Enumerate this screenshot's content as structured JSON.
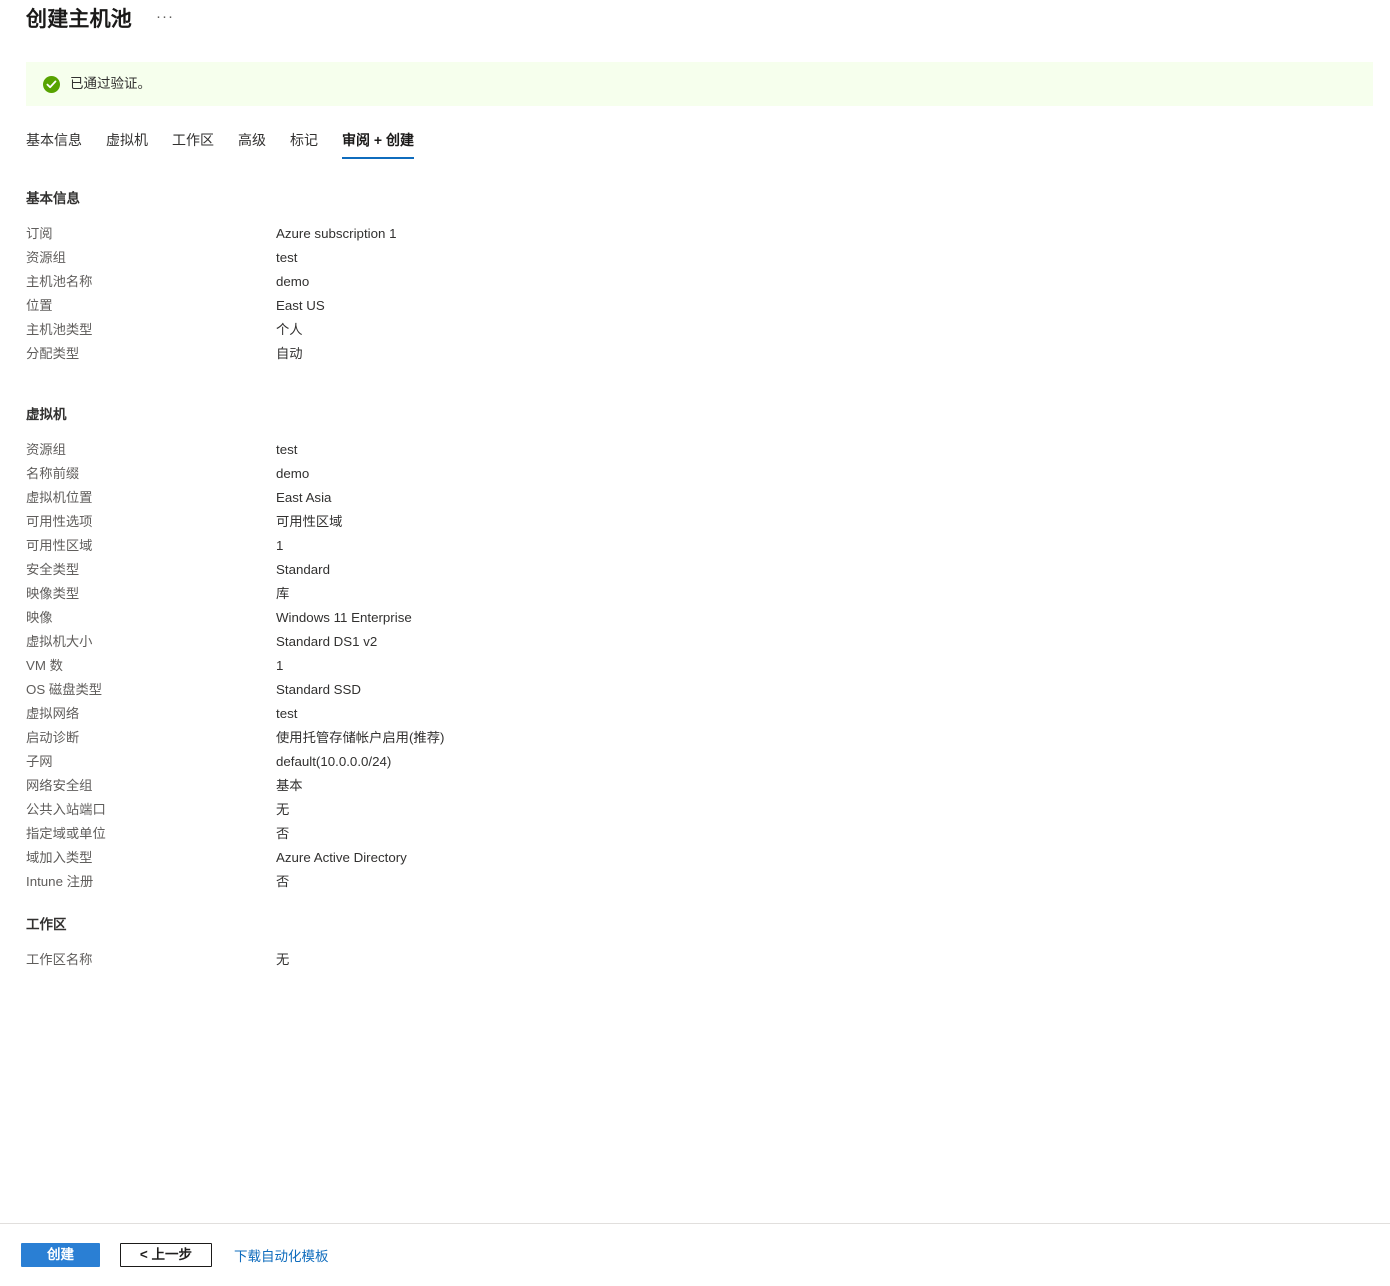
{
  "header": {
    "title": "创建主机池",
    "more_menu": "···"
  },
  "banner": {
    "icon": "check-circle-icon",
    "text": "已通过验证。",
    "background_color": "#f6ffed",
    "icon_color": "#57a300"
  },
  "tabs": [
    {
      "label": "基本信息",
      "active": false
    },
    {
      "label": "虚拟机",
      "active": false
    },
    {
      "label": "工作区",
      "active": false
    },
    {
      "label": "高级",
      "active": false
    },
    {
      "label": "标记",
      "active": false
    },
    {
      "label": "审阅 + 创建",
      "active": true
    }
  ],
  "sections": [
    {
      "title": "基本信息",
      "rows": [
        {
          "label": "订阅",
          "value": "Azure subscription 1"
        },
        {
          "label": "资源组",
          "value": "test"
        },
        {
          "label": "主机池名称",
          "value": "demo"
        },
        {
          "label": "位置",
          "value": "East US"
        },
        {
          "label": "主机池类型",
          "value": "个人"
        },
        {
          "label": "分配类型",
          "value": "自动"
        }
      ]
    },
    {
      "title": "虚拟机",
      "rows": [
        {
          "label": "资源组",
          "value": "test"
        },
        {
          "label": "名称前缀",
          "value": "demo"
        },
        {
          "label": "虚拟机位置",
          "value": "East Asia"
        },
        {
          "label": "可用性选项",
          "value": "可用性区域"
        },
        {
          "label": "可用性区域",
          "value": "1"
        },
        {
          "label": "安全类型",
          "value": "Standard"
        },
        {
          "label": "映像类型",
          "value": "库"
        },
        {
          "label": "映像",
          "value": "Windows 11 Enterprise"
        },
        {
          "label": "虚拟机大小",
          "value": "Standard DS1 v2"
        },
        {
          "label": "VM 数",
          "value": "1"
        },
        {
          "label": "OS 磁盘类型",
          "value": "Standard SSD"
        },
        {
          "label": "虚拟网络",
          "value": "test"
        },
        {
          "label": "启动诊断",
          "value": "使用托管存储帐户启用(推荐)"
        },
        {
          "label": "子网",
          "value": "default(10.0.0.0/24)"
        },
        {
          "label": "网络安全组",
          "value": "基本"
        },
        {
          "label": "公共入站端口",
          "value": "无"
        },
        {
          "label": "指定域或单位",
          "value": "否"
        },
        {
          "label": "域加入类型",
          "value": "Azure Active Directory"
        },
        {
          "label": "Intune 注册",
          "value": "否"
        }
      ]
    },
    {
      "title": "工作区",
      "rows": [
        {
          "label": "工作区名称",
          "value": "无"
        }
      ]
    }
  ],
  "footer": {
    "create_label": "创建",
    "previous_label": "< 上一步",
    "download_template_label": "下载自动化模板",
    "primary_color": "#2a7fd4",
    "link_color": "#0f6cbd"
  }
}
